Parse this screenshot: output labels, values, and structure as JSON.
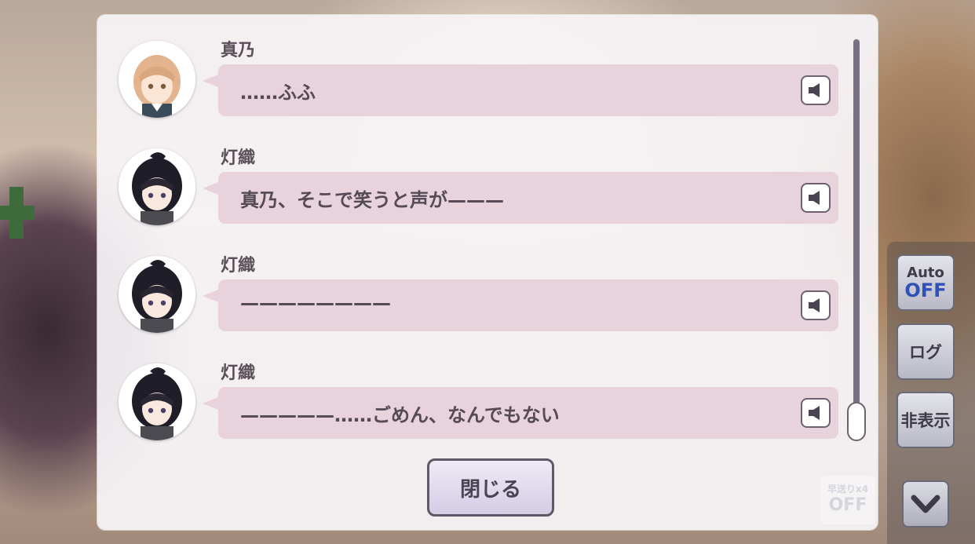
{
  "log": {
    "entries": [
      {
        "speaker": "真乃",
        "text": "……ふふ",
        "avatar_icon": "mano-avatar-icon",
        "voice_icon": "speaker-icon"
      },
      {
        "speaker": "灯織",
        "text": "真乃、そこで笑うと声が———",
        "avatar_icon": "hiori-avatar-icon",
        "voice_icon": "speaker-icon"
      },
      {
        "speaker": "灯織",
        "text": "————————",
        "avatar_icon": "hiori-avatar-icon",
        "voice_icon": "speaker-icon"
      },
      {
        "speaker": "灯織",
        "text": "—————……ごめん、なんでもない",
        "avatar_icon": "hiori-avatar-icon",
        "voice_icon": "speaker-icon"
      }
    ],
    "close_label": "閉じる"
  },
  "controls": {
    "auto_label": "Auto",
    "auto_state": "OFF",
    "log_label": "ログ",
    "hide_label": "非表示",
    "fast_forward_label": "早送りx4",
    "fast_forward_state": "OFF",
    "down_icon": "chevron-down-icon"
  },
  "colors": {
    "bubble": "#e8d3dc",
    "auto_off": "#2f52b8",
    "panel": "#f7f4f8"
  }
}
